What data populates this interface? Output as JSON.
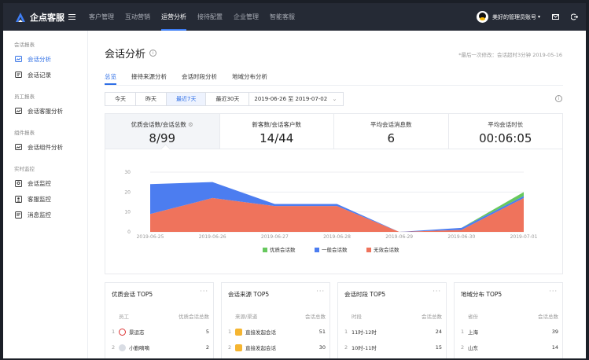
{
  "app": {
    "name": "企点客服"
  },
  "nav": [
    "客户管理",
    "互动营销",
    "运营分析",
    "接待配置",
    "企业管理",
    "智能客服"
  ],
  "nav_active": 2,
  "user": {
    "name": "美好的管理员账号"
  },
  "sidebar": {
    "groups": [
      {
        "title": "会话报表",
        "items": [
          {
            "label": "会话分析",
            "icon": "chart-icon",
            "active": true
          },
          {
            "label": "会话记录",
            "icon": "chat-icon"
          }
        ]
      },
      {
        "title": "员工报表",
        "items": [
          {
            "label": "会话客服分析",
            "icon": "chart-icon"
          }
        ]
      },
      {
        "title": "组件报表",
        "items": [
          {
            "label": "会话组件分析",
            "icon": "chart-icon"
          }
        ]
      },
      {
        "title": "实时监控",
        "items": [
          {
            "label": "会话监控",
            "icon": "monitor-icon"
          },
          {
            "label": "客服监控",
            "icon": "agent-icon"
          },
          {
            "label": "消息监控",
            "icon": "message-icon"
          }
        ]
      }
    ]
  },
  "page": {
    "title": "会话分析",
    "last_update": "*最后一次修改：会话超时3分钟 2019-05-16",
    "tabs": [
      "总览",
      "接待来源分析",
      "会话时段分析",
      "地域分布分析"
    ],
    "filter": {
      "buttons": [
        "今天",
        "昨天",
        "最近7天",
        "最近30天"
      ],
      "active": 2,
      "range": "2019-06-26 至 2019-07-02"
    }
  },
  "kpis": [
    {
      "label": "优质会话数/会话总数",
      "value": "8/99"
    },
    {
      "label": "新客数/会话客户数",
      "value": "14/44"
    },
    {
      "label": "平均会话消息数",
      "value": "6"
    },
    {
      "label": "平均会话时长",
      "value": "00:06:05"
    }
  ],
  "chart_data": {
    "type": "area",
    "x": [
      "2019-06-25",
      "2019-06-26",
      "2019-06-27",
      "2019-06-28",
      "2019-06-29",
      "2019-06-30",
      "2019-07-01"
    ],
    "series": [
      {
        "name": "无效会话数",
        "values": [
          9,
          17,
          13,
          13,
          0,
          1,
          17
        ],
        "color": "#ef735c"
      },
      {
        "name": "一般会话数",
        "values": [
          15,
          8,
          1,
          1,
          0,
          1,
          1
        ],
        "color": "#4c7df0"
      },
      {
        "name": "优质会话数",
        "values": [
          0,
          0,
          0,
          0,
          0,
          0,
          2
        ],
        "color": "#67c85e"
      }
    ],
    "stacked": true,
    "ylim": [
      0,
      30
    ],
    "yticks": [
      0,
      10,
      20,
      30
    ],
    "grid": true,
    "legend": "bottom",
    "legend_order": [
      "优质会话数",
      "一般会话数",
      "无效会话数"
    ]
  },
  "cards": [
    {
      "title": "优质会话 TOP5",
      "head": [
        "员工",
        "优质会话总数"
      ],
      "rows": [
        {
          "name": "景运志",
          "value": "5",
          "icon": "a1"
        },
        {
          "name": "小勤嘀嘀",
          "value": "2",
          "icon": "a2"
        }
      ]
    },
    {
      "title": "会话来源 TOP5",
      "head": [
        "来源/渠道",
        "会话总数"
      ],
      "rows": [
        {
          "name": "直接发起会话",
          "value": "51",
          "icon": "sq"
        },
        {
          "name": "直接发起会话",
          "value": "30",
          "icon": "sq"
        }
      ]
    },
    {
      "title": "会话时段 TOP5",
      "head": [
        "时段",
        "会话总数"
      ],
      "rows": [
        {
          "name": "11时-12时",
          "value": "24"
        },
        {
          "name": "10时-11时",
          "value": "15"
        }
      ]
    },
    {
      "title": "地域分布 TOP5",
      "head": [
        "省份",
        "会话总数"
      ],
      "rows": [
        {
          "name": "上海",
          "value": "39"
        },
        {
          "name": "山东",
          "value": "14"
        }
      ]
    }
  ]
}
